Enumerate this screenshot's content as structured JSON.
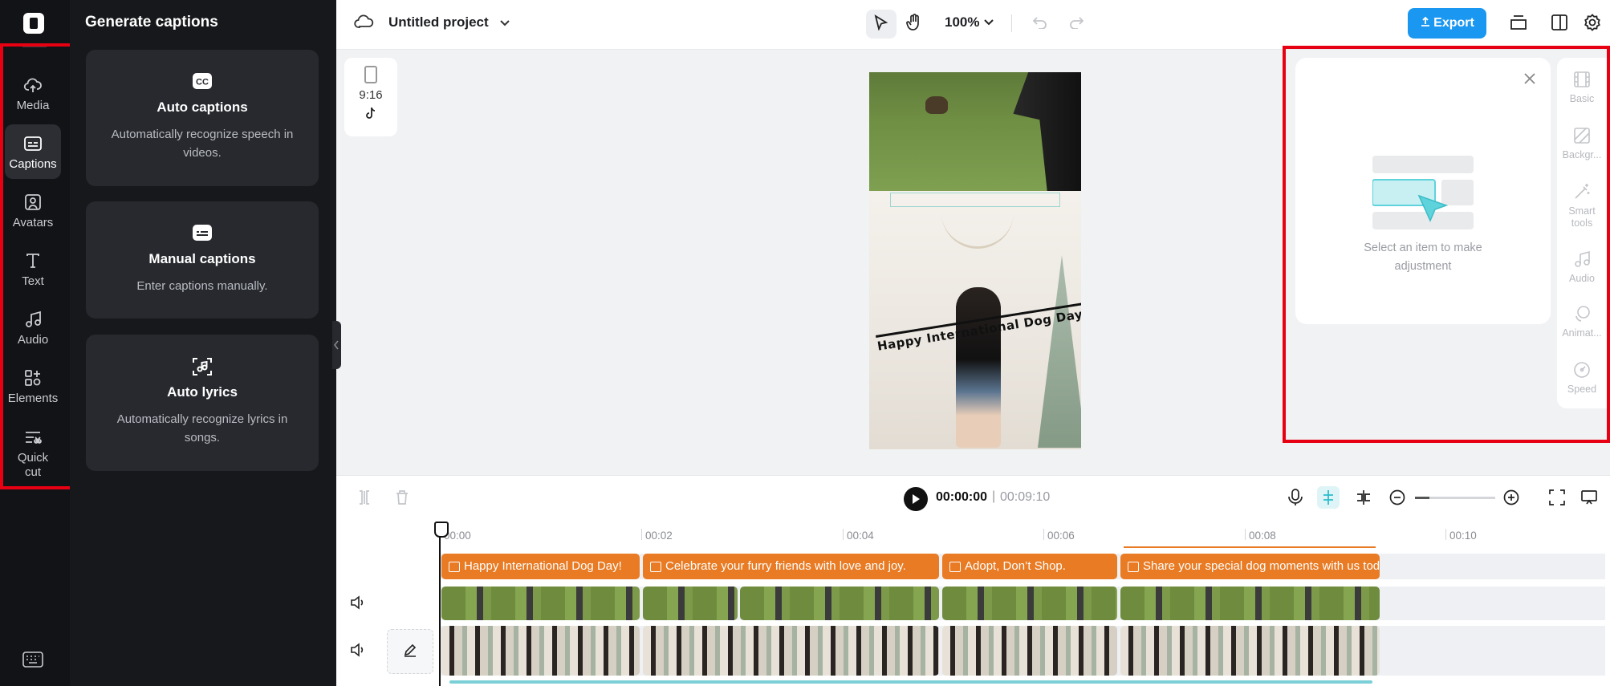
{
  "rail": {
    "items": [
      {
        "label": "Media",
        "icon": "cloud-upload-icon"
      },
      {
        "label": "Captions",
        "icon": "captions-icon",
        "active": true
      },
      {
        "label": "Avatars",
        "icon": "avatar-icon"
      },
      {
        "label": "Text",
        "icon": "text-icon"
      },
      {
        "label": "Audio",
        "icon": "music-note-icon"
      },
      {
        "label": "Elements",
        "icon": "elements-icon"
      },
      {
        "label": "Quick\ncut",
        "icon": "quick-cut-icon"
      }
    ]
  },
  "panel": {
    "title": "Generate captions",
    "cards": [
      {
        "title": "Auto captions",
        "desc": "Automatically recognize speech in videos.",
        "icon": "cc-icon"
      },
      {
        "title": "Manual captions",
        "desc": "Enter captions manually.",
        "icon": "subtitle-icon"
      },
      {
        "title": "Auto lyrics",
        "desc": "Automatically recognize lyrics in songs.",
        "icon": "lyrics-icon"
      }
    ]
  },
  "topbar": {
    "project_title": "Untitled project",
    "zoom": "100%",
    "export_label": "Export"
  },
  "canvas": {
    "ratio_label": "9:16",
    "caption_overlay": "Happy International Dog Day!"
  },
  "properties": {
    "empty_message": "Select an item to make adjustment",
    "tabs": [
      "Basic",
      "Backgr...",
      "Smart tools",
      "Audio",
      "Animat...",
      "Speed"
    ]
  },
  "playback": {
    "current_time": "00:00:00",
    "separator": "|",
    "total_time": "00:09:10"
  },
  "timeline": {
    "ticks": [
      "00:00",
      "00:02",
      "00:04",
      "00:06",
      "00:08",
      "00:10"
    ],
    "caption_clips": [
      "Happy International Dog Day!",
      "Celebrate your furry friends with love and joy.",
      "Adopt, Don’t Shop.",
      "Share your special dog moments with us today!"
    ]
  },
  "colors": {
    "accent": "#1a97f0",
    "caption_clip": "#e87b23",
    "highlight_box": "#e60012"
  }
}
